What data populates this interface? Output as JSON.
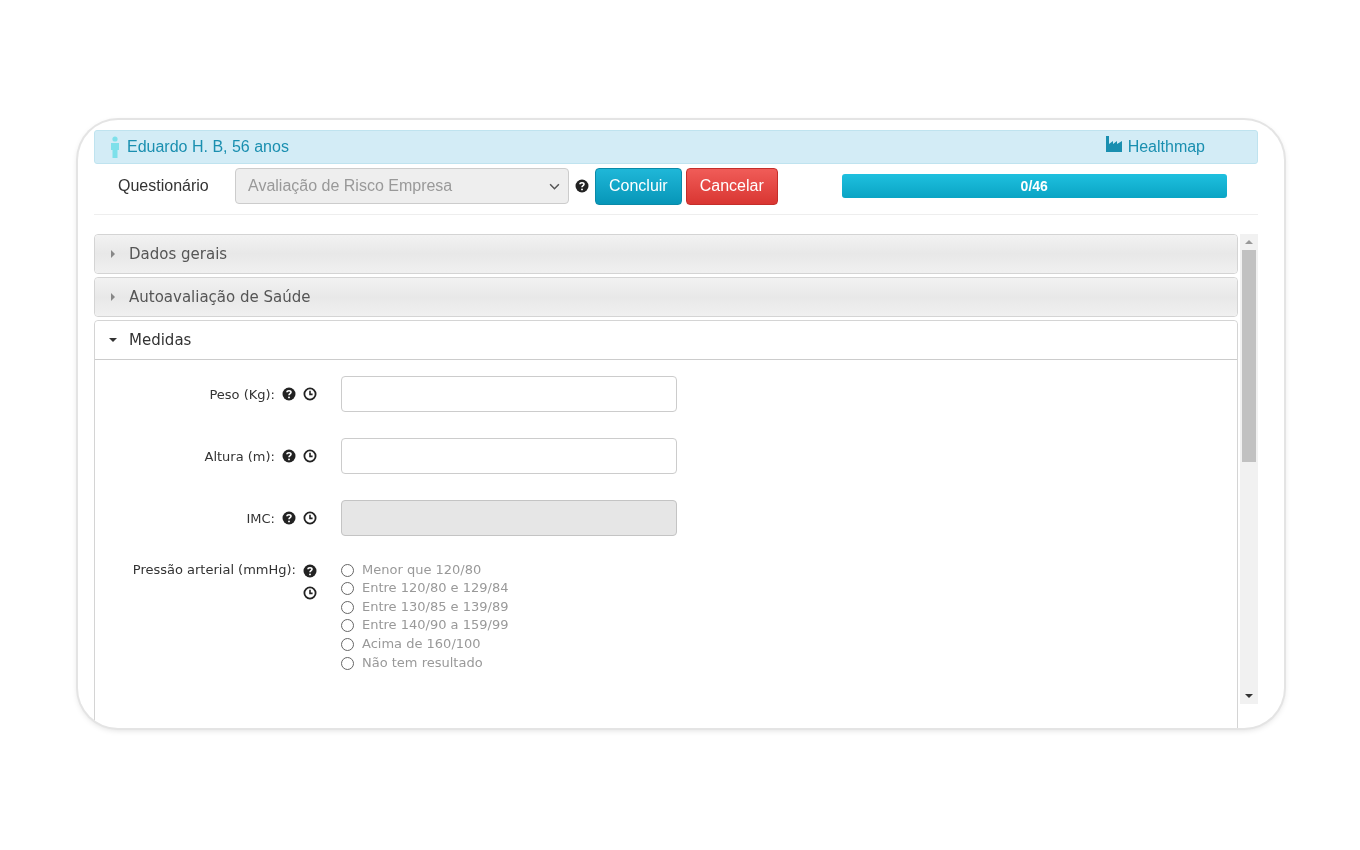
{
  "header": {
    "patient": "Eduardo H. B, 56 anos",
    "brand": "Healthmap"
  },
  "toolbar": {
    "label": "Questionário",
    "select": {
      "value": "Avaliação de Risco Empresa",
      "disabled": true
    },
    "buttons": [
      {
        "label": "Concluir",
        "kind": "primary"
      },
      {
        "label": "Cancelar",
        "kind": "danger"
      }
    ],
    "progress": {
      "label": "0/46",
      "level": 1
    }
  },
  "sections": [
    {
      "title": "Dados gerais",
      "expanded": false
    },
    {
      "title": "Autoavaliação de Saúde",
      "expanded": false
    },
    {
      "title": "Medidas",
      "expanded": true,
      "fields": [
        {
          "label": "Peso (Kg):",
          "kind": "input",
          "disabled": false
        },
        {
          "label": "Altura (m):",
          "kind": "input",
          "disabled": false
        },
        {
          "label": "IMC:",
          "kind": "input",
          "disabled": true
        },
        {
          "label": "Pressão arterial (mmHg):",
          "kind": "radio",
          "options": [
            {
              "label": "Menor que 120/80",
              "selected": false
            },
            {
              "label": "Entre 120/80 e 129/84",
              "selected": false
            },
            {
              "label": "Entre 130/85 e 139/89",
              "selected": false
            },
            {
              "label": "Entre 140/90 a 159/99",
              "selected": false
            },
            {
              "label": "Acima de 160/100",
              "selected": false
            },
            {
              "label": "Não tem resultado",
              "selected": false
            }
          ]
        }
      ]
    }
  ]
}
